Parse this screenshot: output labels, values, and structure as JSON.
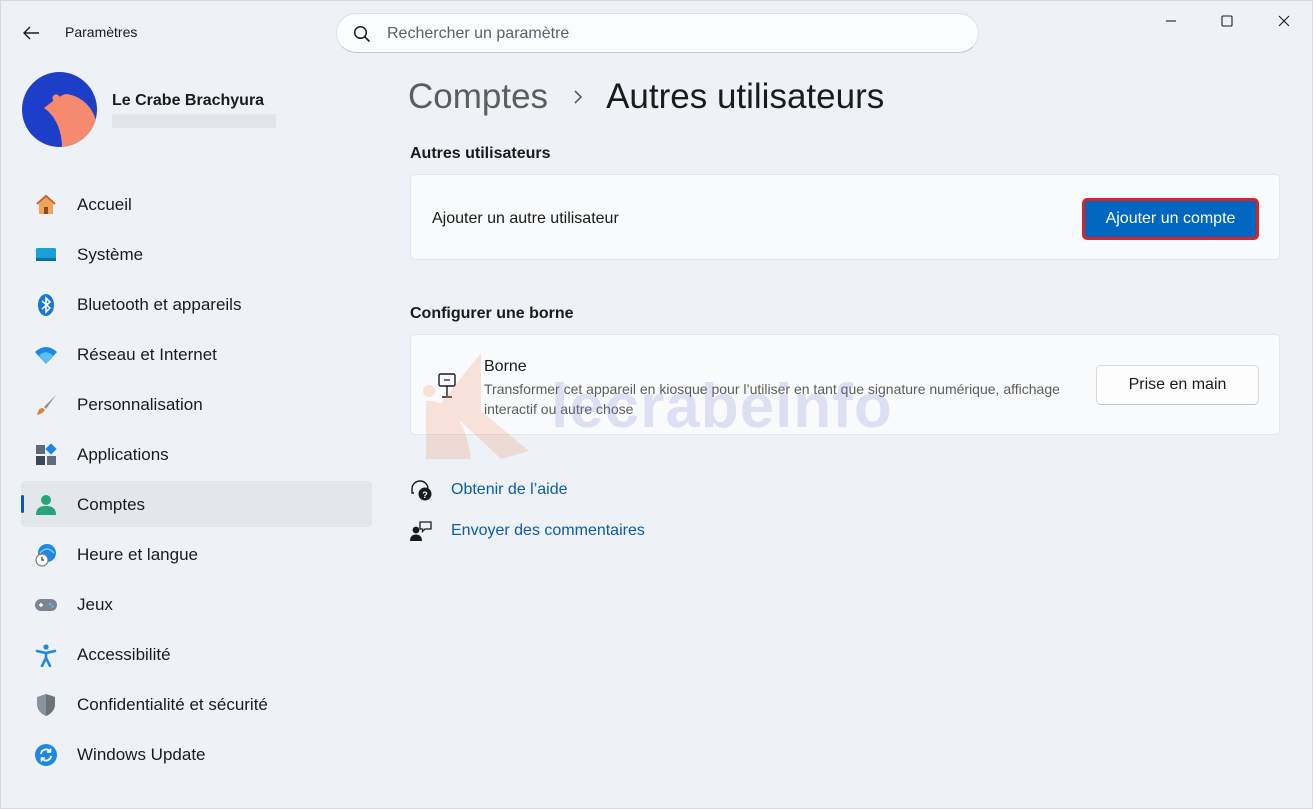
{
  "app": {
    "title": "Paramètres"
  },
  "search": {
    "placeholder": "Rechercher un paramètre"
  },
  "user": {
    "name": "Le Crabe Brachyura"
  },
  "sidebar": {
    "items": [
      {
        "label": "Accueil",
        "icon": "home-icon",
        "active": false
      },
      {
        "label": "Système",
        "icon": "system-icon",
        "active": false
      },
      {
        "label": "Bluetooth et appareils",
        "icon": "bluetooth-icon",
        "active": false
      },
      {
        "label": "Réseau et Internet",
        "icon": "wifi-icon",
        "active": false
      },
      {
        "label": "Personnalisation",
        "icon": "brush-icon",
        "active": false
      },
      {
        "label": "Applications",
        "icon": "apps-icon",
        "active": false
      },
      {
        "label": "Comptes",
        "icon": "accounts-icon",
        "active": true
      },
      {
        "label": "Heure et langue",
        "icon": "time-language-icon",
        "active": false
      },
      {
        "label": "Jeux",
        "icon": "gamepad-icon",
        "active": false
      },
      {
        "label": "Accessibilité",
        "icon": "accessibility-icon",
        "active": false
      },
      {
        "label": "Confidentialité et sécurité",
        "icon": "shield-icon",
        "active": false
      },
      {
        "label": "Windows Update",
        "icon": "update-icon",
        "active": false
      }
    ]
  },
  "breadcrumb": {
    "parent": "Comptes",
    "current": "Autres utilisateurs"
  },
  "other_users": {
    "section_title": "Autres utilisateurs",
    "add_label": "Ajouter un autre utilisateur",
    "add_button": "Ajouter un compte"
  },
  "kiosk": {
    "section_title": "Configurer une borne",
    "title": "Borne",
    "description": "Transformer cet appareil en kiosque pour l’utiliser en tant que signature numérique, affichage interactif ou autre chose",
    "button": "Prise en main"
  },
  "links": {
    "help": "Obtenir de l’aide",
    "feedback": "Envoyer des commentaires"
  },
  "watermark": {
    "text": "lecrabeinfo"
  },
  "colors": {
    "accent": "#0067c0",
    "highlight_border": "#d9232b",
    "link": "#0b5cad",
    "background": "#eef2f7"
  }
}
